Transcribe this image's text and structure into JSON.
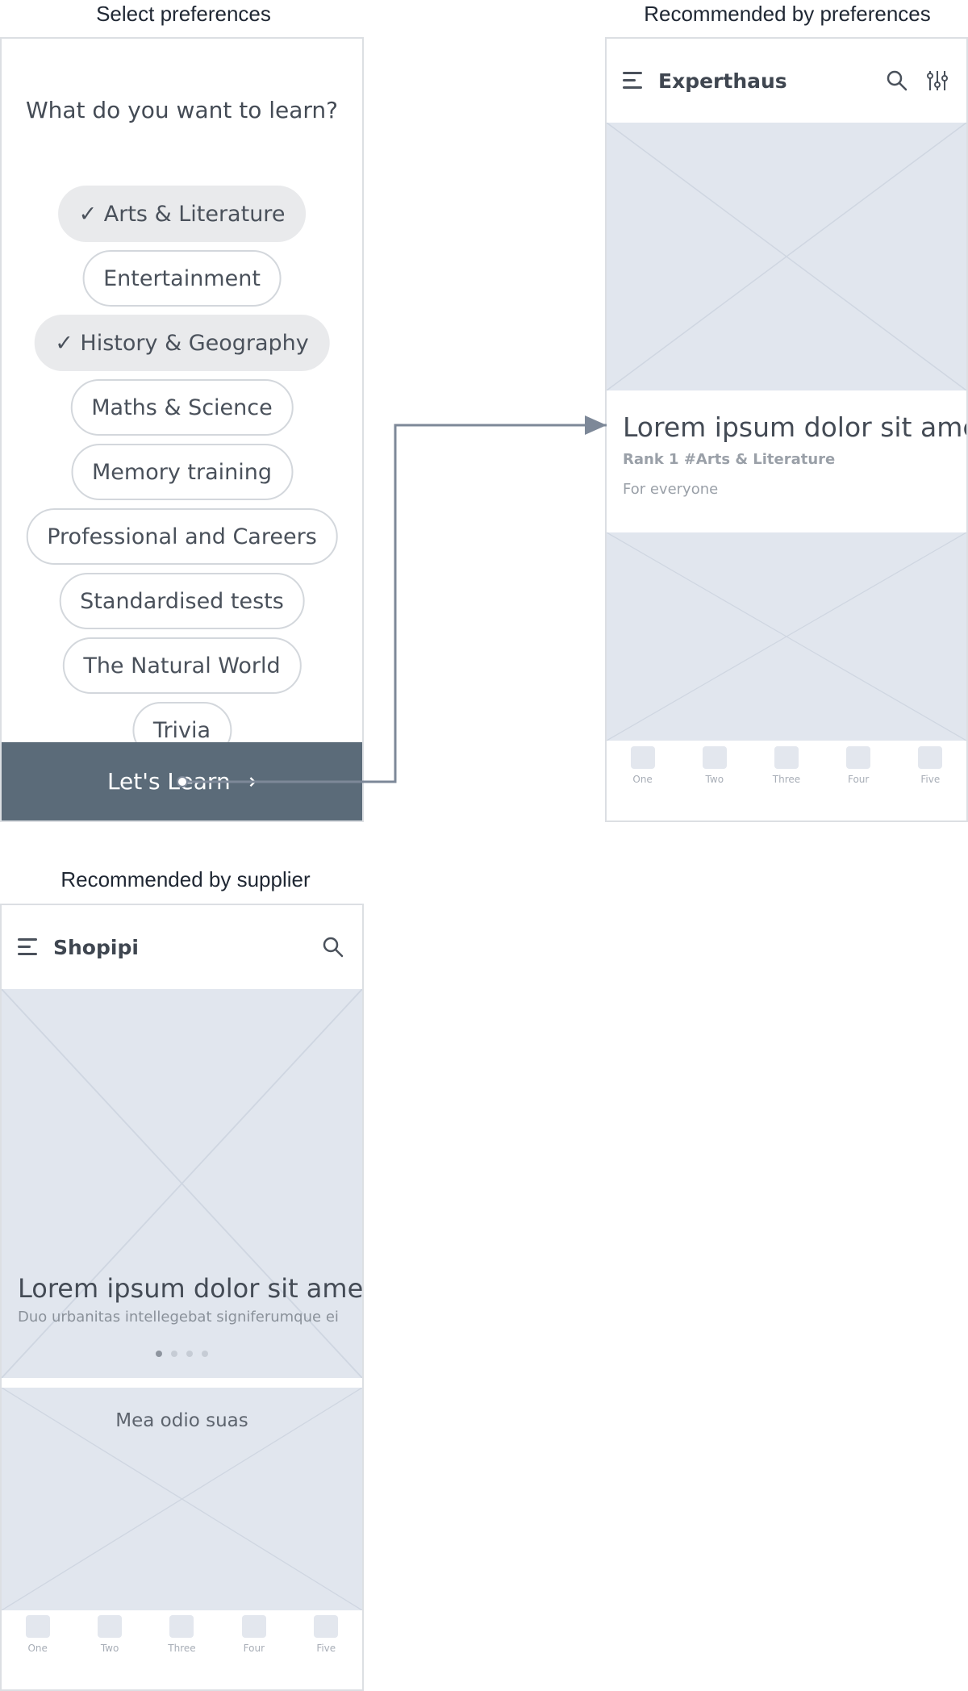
{
  "captions": {
    "prefs": "Select preferences",
    "rec": "Recommended by preferences",
    "supplier": "Recommended by supplier"
  },
  "prefs_screen": {
    "question": "What do you want to learn?",
    "options": [
      {
        "label": "✓ Arts & Literature",
        "selected": true
      },
      {
        "label": "Entertainment",
        "selected": false
      },
      {
        "label": "✓ History & Geography",
        "selected": true
      },
      {
        "label": "Maths & Science",
        "selected": false
      },
      {
        "label": "Memory training",
        "selected": false
      },
      {
        "label": "Professional and Careers",
        "selected": false
      },
      {
        "label": "Standardised tests",
        "selected": false
      },
      {
        "label": "The Natural World",
        "selected": false
      },
      {
        "label": "Trivia",
        "selected": false
      }
    ],
    "cta": "Let's Learn →"
  },
  "rec_screen": {
    "brand": "Experthaus",
    "card_title": "Lorem ipsum dolor sit amet",
    "card_rank": "Rank 1 #Arts & Literature",
    "card_audience": "For everyone",
    "tabs": [
      "One",
      "Two",
      "Three",
      "Four",
      "Five"
    ]
  },
  "supplier_screen": {
    "brand": "Shopipi",
    "hero_title": "Lorem ipsum dolor sit amet",
    "hero_subtitle": "Duo urbanitas intellegebat signiferumque ei",
    "carousel_active_index": 0,
    "carousel_count": 4,
    "section_title": "Mea odio suas",
    "tabs": [
      "One",
      "Two",
      "Three",
      "Four",
      "Five"
    ]
  },
  "colors": {
    "cta_background": "#5b6b79",
    "placeholder": "#e1e6ee",
    "connector": "#7d8898"
  }
}
